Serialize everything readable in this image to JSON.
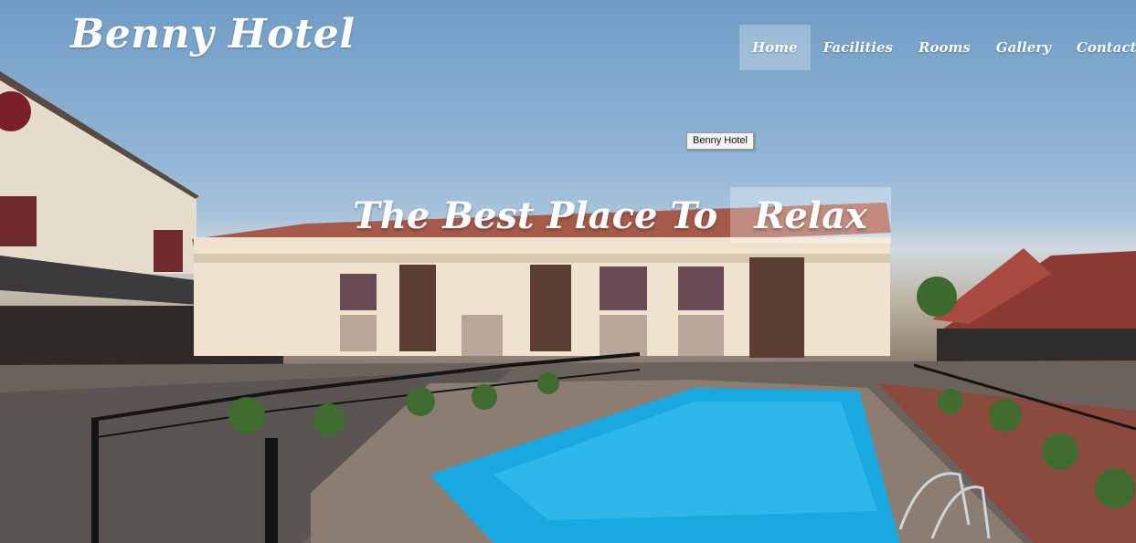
{
  "site": {
    "brand": "Benny Hotel"
  },
  "nav": {
    "items": [
      "Home",
      "Facilities",
      "Rooms",
      "Gallery",
      "Contact"
    ],
    "active": "Home"
  },
  "tooltip": {
    "text": "Benny Hotel"
  },
  "hero": {
    "tagline_prefix": "The Best Place To",
    "tagline_word": "Relax",
    "image": "hotel-pool-building-photo"
  }
}
